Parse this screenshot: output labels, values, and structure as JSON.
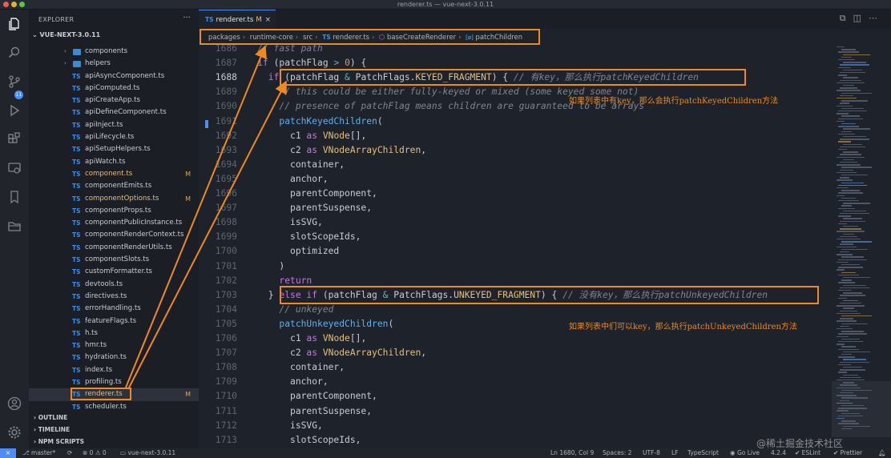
{
  "window": {
    "title": "renderer.ts — vue-next-3.0.11"
  },
  "sidebar": {
    "title": "EXPLORER",
    "more": "···",
    "project": "VUE-NEXT-3.0.11",
    "items": [
      {
        "kind": "folder",
        "label": "components",
        "modified": false,
        "mod": ""
      },
      {
        "kind": "folder",
        "label": "helpers",
        "modified": false,
        "mod": ""
      },
      {
        "kind": "file",
        "label": "apiAsyncComponent.ts",
        "modified": false,
        "mod": ""
      },
      {
        "kind": "file",
        "label": "apiComputed.ts",
        "modified": false,
        "mod": ""
      },
      {
        "kind": "file",
        "label": "apiCreateApp.ts",
        "modified": false,
        "mod": ""
      },
      {
        "kind": "file",
        "label": "apiDefineComponent.ts",
        "modified": false,
        "mod": ""
      },
      {
        "kind": "file",
        "label": "apiInject.ts",
        "modified": false,
        "mod": ""
      },
      {
        "kind": "file",
        "label": "apiLifecycle.ts",
        "modified": false,
        "mod": ""
      },
      {
        "kind": "file",
        "label": "apiSetupHelpers.ts",
        "modified": false,
        "mod": ""
      },
      {
        "kind": "file",
        "label": "apiWatch.ts",
        "modified": false,
        "mod": ""
      },
      {
        "kind": "file",
        "label": "component.ts",
        "modified": true,
        "mod": "M"
      },
      {
        "kind": "file",
        "label": "componentEmits.ts",
        "modified": false,
        "mod": ""
      },
      {
        "kind": "file",
        "label": "componentOptions.ts",
        "modified": true,
        "mod": "M"
      },
      {
        "kind": "file",
        "label": "componentProps.ts",
        "modified": false,
        "mod": ""
      },
      {
        "kind": "file",
        "label": "componentPublicInstance.ts",
        "modified": false,
        "mod": ""
      },
      {
        "kind": "file",
        "label": "componentRenderContext.ts",
        "modified": false,
        "mod": ""
      },
      {
        "kind": "file",
        "label": "componentRenderUtils.ts",
        "modified": false,
        "mod": ""
      },
      {
        "kind": "file",
        "label": "componentSlots.ts",
        "modified": false,
        "mod": ""
      },
      {
        "kind": "file",
        "label": "customFormatter.ts",
        "modified": false,
        "mod": ""
      },
      {
        "kind": "file",
        "label": "devtools.ts",
        "modified": false,
        "mod": ""
      },
      {
        "kind": "file",
        "label": "directives.ts",
        "modified": false,
        "mod": ""
      },
      {
        "kind": "file",
        "label": "errorHandling.ts",
        "modified": false,
        "mod": ""
      },
      {
        "kind": "file",
        "label": "featureFlags.ts",
        "modified": false,
        "mod": ""
      },
      {
        "kind": "file",
        "label": "h.ts",
        "modified": false,
        "mod": ""
      },
      {
        "kind": "file",
        "label": "hmr.ts",
        "modified": false,
        "mod": ""
      },
      {
        "kind": "file",
        "label": "hydration.ts",
        "modified": false,
        "mod": ""
      },
      {
        "kind": "file",
        "label": "index.ts",
        "modified": false,
        "mod": ""
      },
      {
        "kind": "file",
        "label": "profiling.ts",
        "modified": false,
        "mod": ""
      },
      {
        "kind": "file",
        "label": "renderer.ts",
        "modified": true,
        "mod": "M",
        "selected": true
      },
      {
        "kind": "file",
        "label": "scheduler.ts",
        "modified": false,
        "mod": ""
      }
    ],
    "file_badge": "TS",
    "sections": [
      "OUTLINE",
      "TIMELINE",
      "NPM SCRIPTS"
    ]
  },
  "activity": {
    "scm_badge": "11"
  },
  "tab": {
    "label": "renderer.ts",
    "status": "M",
    "badge": "TS",
    "close": "×"
  },
  "breadcrumb": [
    "packages",
    "runtime-core",
    "src",
    "renderer.ts",
    "baseCreateRenderer",
    "patchChildren"
  ],
  "code": {
    "lines": [
      {
        "n": "1686",
        "tokens": [
          [
            "cm",
            "    // fast path"
          ]
        ]
      },
      {
        "n": "1687",
        "tokens": [
          [
            "kw",
            "    if"
          ],
          [
            "pn",
            " (patchFlag "
          ],
          [
            "op",
            ">"
          ],
          [
            "pn",
            " "
          ],
          [
            "num",
            "0"
          ],
          [
            "pn",
            ") {"
          ]
        ]
      },
      {
        "n": "1688",
        "tokens": [
          [
            "kw",
            "      if"
          ],
          [
            "pn",
            " (patchFlag "
          ],
          [
            "op",
            "&"
          ],
          [
            "pn",
            " PatchFlags."
          ],
          [
            "ty",
            "KEYED_FRAGMENT"
          ],
          [
            "pn",
            ") { "
          ],
          [
            "cm",
            "// 有key，那么执行patchKeyedChildren"
          ]
        ]
      },
      {
        "n": "1689",
        "tokens": [
          [
            "cm",
            "        // this could be either fully-keyed or mixed (some keyed some not)"
          ]
        ]
      },
      {
        "n": "1690",
        "tokens": [
          [
            "cm",
            "        // presence of patchFlag means children are guaranteed to be arrays"
          ]
        ]
      },
      {
        "n": "1691",
        "tokens": [
          [
            "fn",
            "        patchKeyedChildren"
          ],
          [
            "pn",
            "("
          ]
        ]
      },
      {
        "n": "1692",
        "tokens": [
          [
            "pn",
            "          c1 "
          ],
          [
            "kw",
            "as"
          ],
          [
            "pn",
            " "
          ],
          [
            "ty",
            "VNode"
          ],
          [
            "pn",
            "[],"
          ]
        ]
      },
      {
        "n": "1693",
        "tokens": [
          [
            "pn",
            "          c2 "
          ],
          [
            "kw",
            "as"
          ],
          [
            "pn",
            " "
          ],
          [
            "ty",
            "VNodeArrayChildren"
          ],
          [
            "pn",
            ","
          ]
        ]
      },
      {
        "n": "1694",
        "tokens": [
          [
            "pn",
            "          container,"
          ]
        ]
      },
      {
        "n": "1695",
        "tokens": [
          [
            "pn",
            "          anchor,"
          ]
        ]
      },
      {
        "n": "1696",
        "tokens": [
          [
            "pn",
            "          parentComponent,"
          ]
        ]
      },
      {
        "n": "1697",
        "tokens": [
          [
            "pn",
            "          parentSuspense,"
          ]
        ]
      },
      {
        "n": "1698",
        "tokens": [
          [
            "pn",
            "          isSVG,"
          ]
        ]
      },
      {
        "n": "1699",
        "tokens": [
          [
            "pn",
            "          slotScopeIds,"
          ]
        ]
      },
      {
        "n": "1700",
        "tokens": [
          [
            "pn",
            "          optimized"
          ]
        ]
      },
      {
        "n": "1701",
        "tokens": [
          [
            "pn",
            "        )"
          ]
        ]
      },
      {
        "n": "1702",
        "tokens": [
          [
            "kw",
            "        return"
          ]
        ]
      },
      {
        "n": "1703",
        "tokens": [
          [
            "pn",
            "      } "
          ],
          [
            "kw",
            "else if"
          ],
          [
            "pn",
            " (patchFlag "
          ],
          [
            "op",
            "&"
          ],
          [
            "pn",
            " PatchFlags."
          ],
          [
            "ty",
            "UNKEYED_FRAGMENT"
          ],
          [
            "pn",
            ") { "
          ],
          [
            "cm",
            "// 没有key，那么执行patchUnkeyedChildren"
          ]
        ]
      },
      {
        "n": "1704",
        "tokens": [
          [
            "cm",
            "        // unkeyed"
          ]
        ]
      },
      {
        "n": "1705",
        "tokens": [
          [
            "fn",
            "        patchUnkeyedChildren"
          ],
          [
            "pn",
            "("
          ]
        ]
      },
      {
        "n": "1706",
        "tokens": [
          [
            "pn",
            "          c1 "
          ],
          [
            "kw",
            "as"
          ],
          [
            "pn",
            " "
          ],
          [
            "ty",
            "VNode"
          ],
          [
            "pn",
            "[],"
          ]
        ]
      },
      {
        "n": "1707",
        "tokens": [
          [
            "pn",
            "          c2 "
          ],
          [
            "kw",
            "as"
          ],
          [
            "pn",
            " "
          ],
          [
            "ty",
            "VNodeArrayChildren"
          ],
          [
            "pn",
            ","
          ]
        ]
      },
      {
        "n": "1708",
        "tokens": [
          [
            "pn",
            "          container,"
          ]
        ]
      },
      {
        "n": "1709",
        "tokens": [
          [
            "pn",
            "          anchor,"
          ]
        ]
      },
      {
        "n": "1710",
        "tokens": [
          [
            "pn",
            "          parentComponent,"
          ]
        ]
      },
      {
        "n": "1711",
        "tokens": [
          [
            "pn",
            "          parentSuspense,"
          ]
        ]
      },
      {
        "n": "1712",
        "tokens": [
          [
            "pn",
            "          isSVG,"
          ]
        ]
      },
      {
        "n": "1713",
        "tokens": [
          [
            "pn",
            "          slotScopeIds,"
          ]
        ]
      }
    ]
  },
  "annotations": {
    "keyed": "如果列表中有key，那么会执行patchKeyedChildren方法",
    "unkeyed": "如果列表中们可以key，那么执行patchUnkeyedChildren方法"
  },
  "status": {
    "branch": "master*",
    "problems": "⊗ 0 ⚠ 0",
    "folder": "vue-next-3.0.11",
    "position": "Ln 1680, Col 9",
    "spaces": "Spaces: 2",
    "encoding": "UTF-8",
    "eol": "LF",
    "language": "TypeScript",
    "golive": "Go Live",
    "version": "4.2.4",
    "eslint": "✔ ESLint",
    "prettier": "✔ Prettier"
  },
  "watermark": "@稀土掘金技术社区",
  "colors": {
    "highlight": "#f08a1e",
    "accent": "#4e8cf7",
    "background": "#1e222a"
  },
  "icons": [
    "files-icon",
    "search-icon",
    "source-control-icon",
    "run-debug-icon",
    "extensions-icon",
    "remote-explorer-icon",
    "bookmarks-icon",
    "folder-icon",
    "account-icon",
    "settings-gear-icon"
  ]
}
